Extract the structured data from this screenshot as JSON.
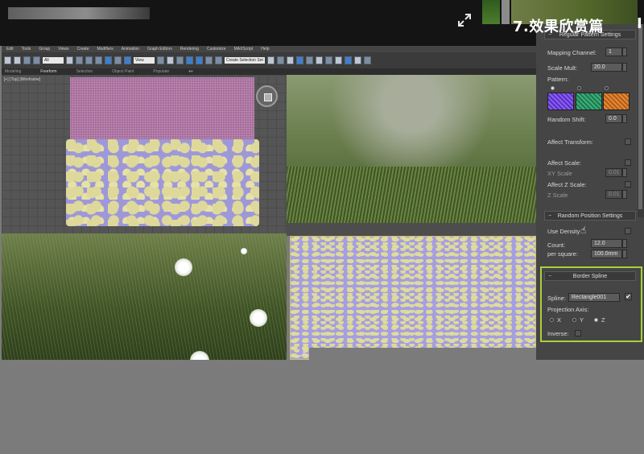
{
  "header": {
    "slide_title": "7.效果欣赏篇",
    "cut_char": "I"
  },
  "menu": {
    "items": [
      "Edit",
      "Tools",
      "Group",
      "Views",
      "Create",
      "Modifiers",
      "Animation",
      "Graph Editors",
      "Rendering",
      "Customize",
      "MAXScript",
      "Help"
    ]
  },
  "toolbar": {
    "selection_filter": "All",
    "reference_coord": "View",
    "named_selection": "Create Selection Set"
  },
  "ribbon": {
    "tabs": [
      "Modeling",
      "Freeform",
      "Selection",
      "Object Paint",
      "Populate"
    ],
    "active_tab": "Freeform"
  },
  "viewport_top": {
    "label": "[+] [Top] [Wireframe]"
  },
  "panel": {
    "regular_pattern": {
      "header": "Regular Pattern Settings",
      "mapping_channel_label": "Mapping Channel:",
      "mapping_channel_value": "1",
      "scale_mult_label": "Scale Mult:",
      "scale_mult_value": "20.0",
      "pattern_label": "Pattern:",
      "random_shift_label": "Random Shift:",
      "random_shift_value": "0.0",
      "affect_transform_label": "Affect Transform:",
      "affect_scale_label": "Affect Scale:",
      "xy_scale_label": "XY Scale",
      "xy_scale_value": "0.01",
      "affect_z_label": "Affect Z Scale:",
      "z_scale_label": "Z Scale",
      "z_scale_value": "0.01"
    },
    "random_position": {
      "header": "Random Position Settings",
      "use_density_label": "Use Density",
      "count_label": "Count:",
      "count_value": "12.0",
      "per_square_label": "per square:",
      "per_square_value": "100.0mm"
    },
    "border_spline": {
      "header": "Border Spline",
      "spline_label": "Spline:",
      "spline_value": "Rectangle001",
      "projection_axis_label": "Projection Axis:",
      "axis_x": "X",
      "axis_y": "Y",
      "axis_z": "Z",
      "selected_axis": "Z",
      "inverse_label": "Inverse:"
    }
  },
  "colors": {
    "highlight_box": "#a9d13b",
    "pattern_1": "#6a3fd0",
    "pattern_2": "#1f8a5a",
    "pattern_3": "#c86a1e"
  }
}
